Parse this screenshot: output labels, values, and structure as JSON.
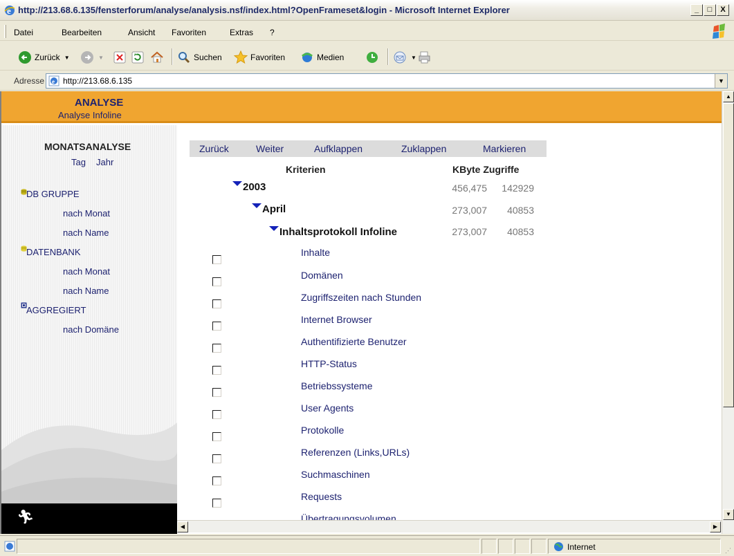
{
  "window": {
    "title": "http://213.68.6.135/fensterforum/analyse/analysis.nsf/index.html?OpenFrameset&login - Microsoft Internet Explorer",
    "min_label": "_",
    "max_label": "□",
    "close_label": "X"
  },
  "menu": {
    "items": [
      "Datei",
      "Bearbeiten",
      "Ansicht",
      "Favoriten",
      "Extras",
      "?"
    ]
  },
  "toolbar": {
    "back_label": "Zurück",
    "search_label": "Suchen",
    "favorites_label": "Favoriten",
    "media_label": "Medien"
  },
  "address": {
    "label": "Adresse",
    "url": "http://213.68.6.135"
  },
  "banner": {
    "title": "ANALYSE",
    "subtitle": "Analyse Infoline"
  },
  "sidebar": {
    "title": "MONATSANALYSE",
    "sub_tag": "Tag",
    "sub_jahr": "Jahr",
    "groups": [
      {
        "label": "DB GRUPPE",
        "links": [
          "nach Monat",
          "nach Name"
        ]
      },
      {
        "label": "DATENBANK",
        "links": [
          "nach Monat",
          "nach Name"
        ]
      },
      {
        "label": "AGGREGIERT",
        "links": [
          "nach Domäne"
        ]
      }
    ]
  },
  "actions": [
    "Zurück",
    "Weiter",
    "Aufklappen",
    "Zuklappen",
    "Markieren"
  ],
  "table": {
    "col_kriterien": "Kriterien",
    "col_kbyte_zugriffe": "KByte Zugriffe",
    "tree": [
      {
        "label": "2003",
        "kbyte": "456,475",
        "zugriffe": "142929"
      },
      {
        "label": "April",
        "kbyte": "273,007",
        "zugriffe": "40853"
      },
      {
        "label": "Inhaltsprotokoll Infoline",
        "kbyte": "273,007",
        "zugriffe": "40853"
      }
    ],
    "items": [
      "Inhalte",
      "Domänen",
      "Zugriffszeiten nach Stunden",
      "Internet Browser",
      "Authentifizierte Benutzer",
      "HTTP-Status",
      "Betriebssysteme",
      "User Agents",
      "Protokolle",
      "Referenzen (Links,URLs)",
      "Suchmaschinen",
      "Requests",
      "Übertragungsvolumen"
    ]
  },
  "status": {
    "zone": "Internet"
  },
  "icons": {
    "titlebar": "ie-logo-icon",
    "side_db": "database-icon",
    "side_agg": "aggregate-icon",
    "tree": "expand-triangle-icon",
    "footer": "running-man-icon"
  },
  "colors": {
    "banner": "#f0a530",
    "link": "#1d2270",
    "tree_triangle": "#1422b8"
  }
}
